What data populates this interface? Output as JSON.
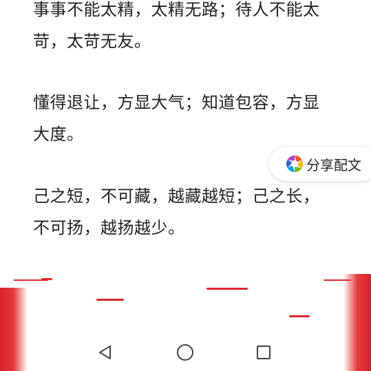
{
  "article": {
    "paragraphs": [
      {
        "lines": [
          "事事不能太精，太精无路；待人不能太",
          "苛，太苛无友。"
        ]
      },
      {
        "lines": [
          "懂得退让，方显大气；知道包容，方显",
          "大度。"
        ]
      },
      {
        "lines": [
          "己之短，不可藏，越藏越短；己之长，",
          "不可扬，越扬越少。"
        ]
      }
    ]
  },
  "share_button": {
    "label": "分享配文",
    "icon": "aperture-icon"
  },
  "banner": {
    "accent_color": "#e0262d"
  },
  "navigation_bar": {
    "back_icon": "back-triangle-icon",
    "home_icon": "home-circle-icon",
    "recent_icon": "recent-apps-square-icon"
  }
}
